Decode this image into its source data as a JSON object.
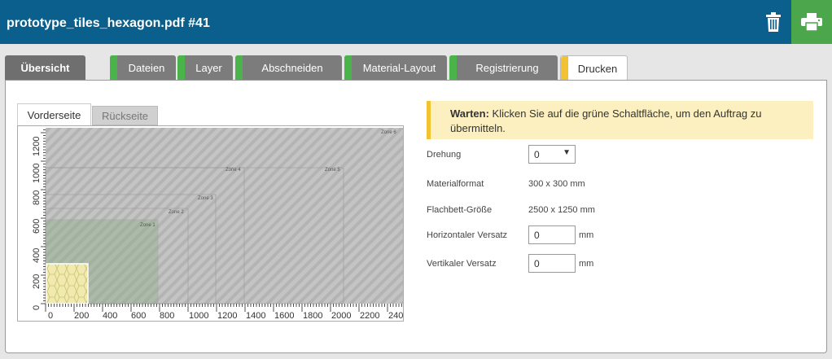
{
  "header": {
    "title": "prototype_tiles_hexagon.pdf #41",
    "trash_icon": "trash-icon",
    "print_icon": "printer-icon"
  },
  "tabs": [
    {
      "label": "Übersicht"
    },
    {
      "label": "Dateien"
    },
    {
      "label": "Layer"
    },
    {
      "label": "Abschneiden"
    },
    {
      "label": "Material-Layout"
    },
    {
      "label": "Registrierung"
    },
    {
      "label": "Drucken"
    }
  ],
  "subtabs": {
    "front": "Vorderseite",
    "back": "Rückseite"
  },
  "canvas": {
    "y_ticks": [
      "0",
      "200",
      "400",
      "600",
      "800",
      "1000",
      "1200"
    ],
    "x_ticks": [
      "0",
      "200",
      "400",
      "600",
      "800",
      "1000",
      "1200",
      "1400",
      "1600",
      "1800",
      "2000",
      "2200",
      "240"
    ],
    "zones": [
      "Zone 1",
      "Zone 2",
      "Zone 3",
      "Zone 4",
      "Zone 5",
      "Zone 6"
    ]
  },
  "warning": {
    "strong": "Warten:",
    "text": " Klicken Sie auf die grüne Schaltfläche, um den Auftrag zu übermitteln."
  },
  "form": {
    "rotation_label": "Drehung",
    "rotation_value": "0",
    "material_format_label": "Materialformat",
    "material_format_value": "300 x 300 mm",
    "flatbed_label": "Flachbett-Größe",
    "flatbed_value": "2500 x 1250 mm",
    "h_offset_label": "Horizontaler Versatz",
    "h_offset_value": "0",
    "h_offset_unit": "mm",
    "v_offset_label": "Vertikaler Versatz",
    "v_offset_value": "0",
    "v_offset_unit": "mm"
  }
}
